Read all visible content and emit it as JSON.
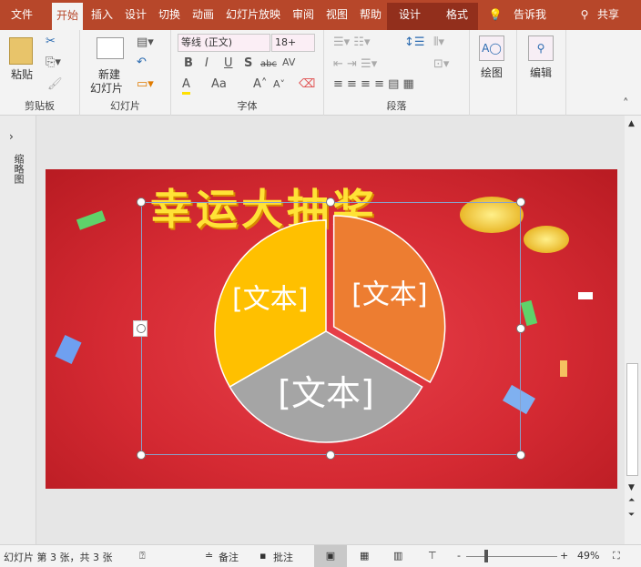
{
  "tabs": [
    "文件",
    "开始",
    "插入",
    "设计",
    "切换",
    "动画",
    "幻灯片放映",
    "审阅",
    "视图",
    "帮助",
    "设计",
    "格式"
  ],
  "tell_me": "告诉我",
  "share": "共享",
  "ribbon": {
    "clipboard": {
      "label": "剪贴板",
      "paste": "粘贴"
    },
    "slides": {
      "label": "幻灯片",
      "new_slide_1": "新建",
      "new_slide_2": "幻灯片"
    },
    "font": {
      "label": "字体",
      "font_name": "等线 (正文)",
      "font_size": "18+",
      "bold": "B",
      "italic": "I",
      "underline": "U",
      "shadow": "S",
      "strike": "abc",
      "spacing": "AV",
      "color": "A",
      "case": "Aa"
    },
    "paragraph": {
      "label": "段落"
    },
    "drawing": {
      "label": "绘图"
    },
    "editing": {
      "label": "编辑"
    }
  },
  "thumbnail_pane": "缩略图",
  "slide": {
    "title": "幸运大抽奖",
    "slices": [
      {
        "label": "[文本]",
        "value": 1,
        "color": "#ed7d31"
      },
      {
        "label": "[文本]",
        "value": 1,
        "color": "#a5a5a5"
      },
      {
        "label": "[文本]",
        "value": 1,
        "color": "#ffc000"
      }
    ]
  },
  "status": {
    "slide_info": "幻灯片 第 3 张，共 3 张",
    "notes": "备注",
    "comments": "批注",
    "zoom": "49%",
    "zoom_fraction": 0.49
  }
}
